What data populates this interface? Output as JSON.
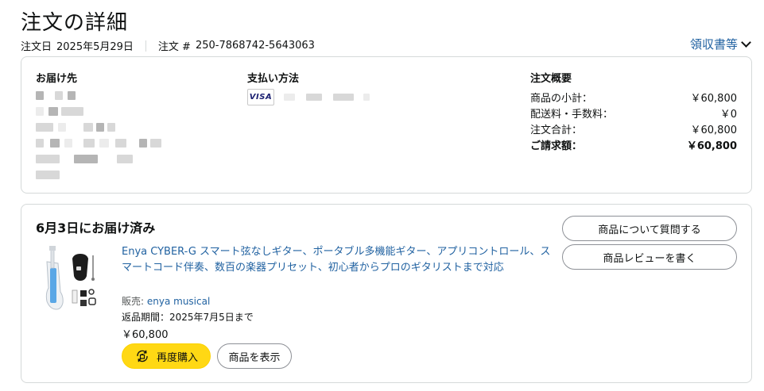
{
  "page": {
    "title": "注文の詳細"
  },
  "order_meta": {
    "date_label": "注文日",
    "date_value": "2025年5月29日",
    "number_label": "注文 #",
    "number_value": "250-7868742-5643063",
    "receipt_link": "領収書等"
  },
  "shipping": {
    "heading": "お届け先"
  },
  "payment": {
    "heading": "支払い方法",
    "card_brand": "VISA"
  },
  "summary": {
    "heading": "注文概要",
    "rows": [
      {
        "label": "商品の小計：",
        "value": "￥60,800"
      },
      {
        "label": "配送料・手数料：",
        "value": "￥0"
      },
      {
        "label": "注文合計：",
        "value": "￥60,800"
      },
      {
        "label": "ご請求額：",
        "value": "￥60,800"
      }
    ]
  },
  "shipment": {
    "status": "6月3日にお届け済み",
    "product_title": "Enya CYBER-G スマート弦なしギター、ポータブル多機能ギター、アプリコントロール、スマートコード伴奏、数百の楽器プリセット、初心者からプロのギタリストまで対応",
    "seller_label": "販売:",
    "seller_name": "enya musical",
    "return_window": "返品期間：2025年7月5日まで",
    "price": "￥60,800",
    "buy_again_label": "再度購入",
    "view_item_label": "商品を表示",
    "ask_question_label": "商品について質問する",
    "write_review_label": "商品レビューを書く"
  },
  "colors": {
    "link": "#2162a1",
    "buy_button": "#ffd814",
    "border": "#d5d9d9"
  }
}
